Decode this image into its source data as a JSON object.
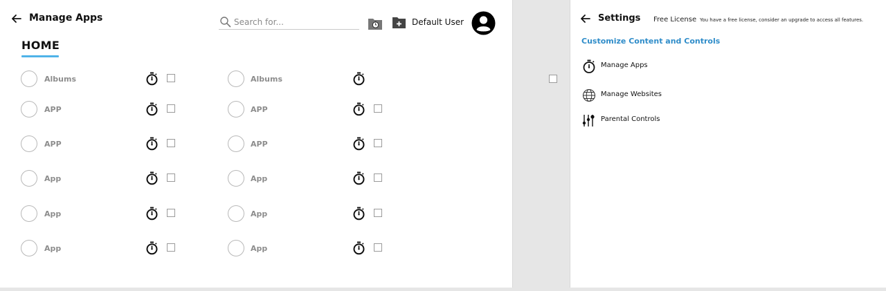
{
  "left_panel": {
    "title": "Manage Apps",
    "search": {
      "placeholder": "Search for..."
    },
    "user": {
      "name": "Default User"
    },
    "tab": {
      "label": "HOME"
    },
    "icons": {
      "back": "arrow-left-icon",
      "search": "search-icon",
      "timer_folder": "folder-timer-icon",
      "add_folder": "folder-add-icon",
      "avatar": "user-avatar-icon",
      "timer": "stopwatch-icon"
    },
    "columns": [
      {
        "apps": [
          {
            "label": "Albums",
            "has_checkbox": true
          },
          {
            "label": "APP",
            "has_checkbox": true
          },
          {
            "label": "APP",
            "has_checkbox": true
          },
          {
            "label": "App",
            "has_checkbox": true
          },
          {
            "label": "App",
            "has_checkbox": true
          },
          {
            "label": "App",
            "has_checkbox": true
          }
        ]
      },
      {
        "apps": [
          {
            "label": "Albums",
            "has_checkbox": false
          },
          {
            "label": "APP",
            "has_checkbox": true
          },
          {
            "label": "APP",
            "has_checkbox": true
          },
          {
            "label": "App",
            "has_checkbox": true
          },
          {
            "label": "App",
            "has_checkbox": true
          },
          {
            "label": "App",
            "has_checkbox": true
          }
        ]
      }
    ]
  },
  "right_panel": {
    "title": "Settings",
    "license": "Free License",
    "license_note": "You have a free license, consider an upgrade to access all features.",
    "section": "Customize Content and Controls",
    "menu": [
      {
        "label": "Manage Apps",
        "icon": "stopwatch-icon"
      },
      {
        "label": "Manage Websites",
        "icon": "globe-icon"
      },
      {
        "label": "Parental Controls",
        "icon": "sliders-icon"
      }
    ]
  },
  "colors": {
    "accent": "#4fb3e8",
    "section_link": "#2e8cc9",
    "app_label": "#8d8d8d",
    "background": "#e6e6e6"
  }
}
